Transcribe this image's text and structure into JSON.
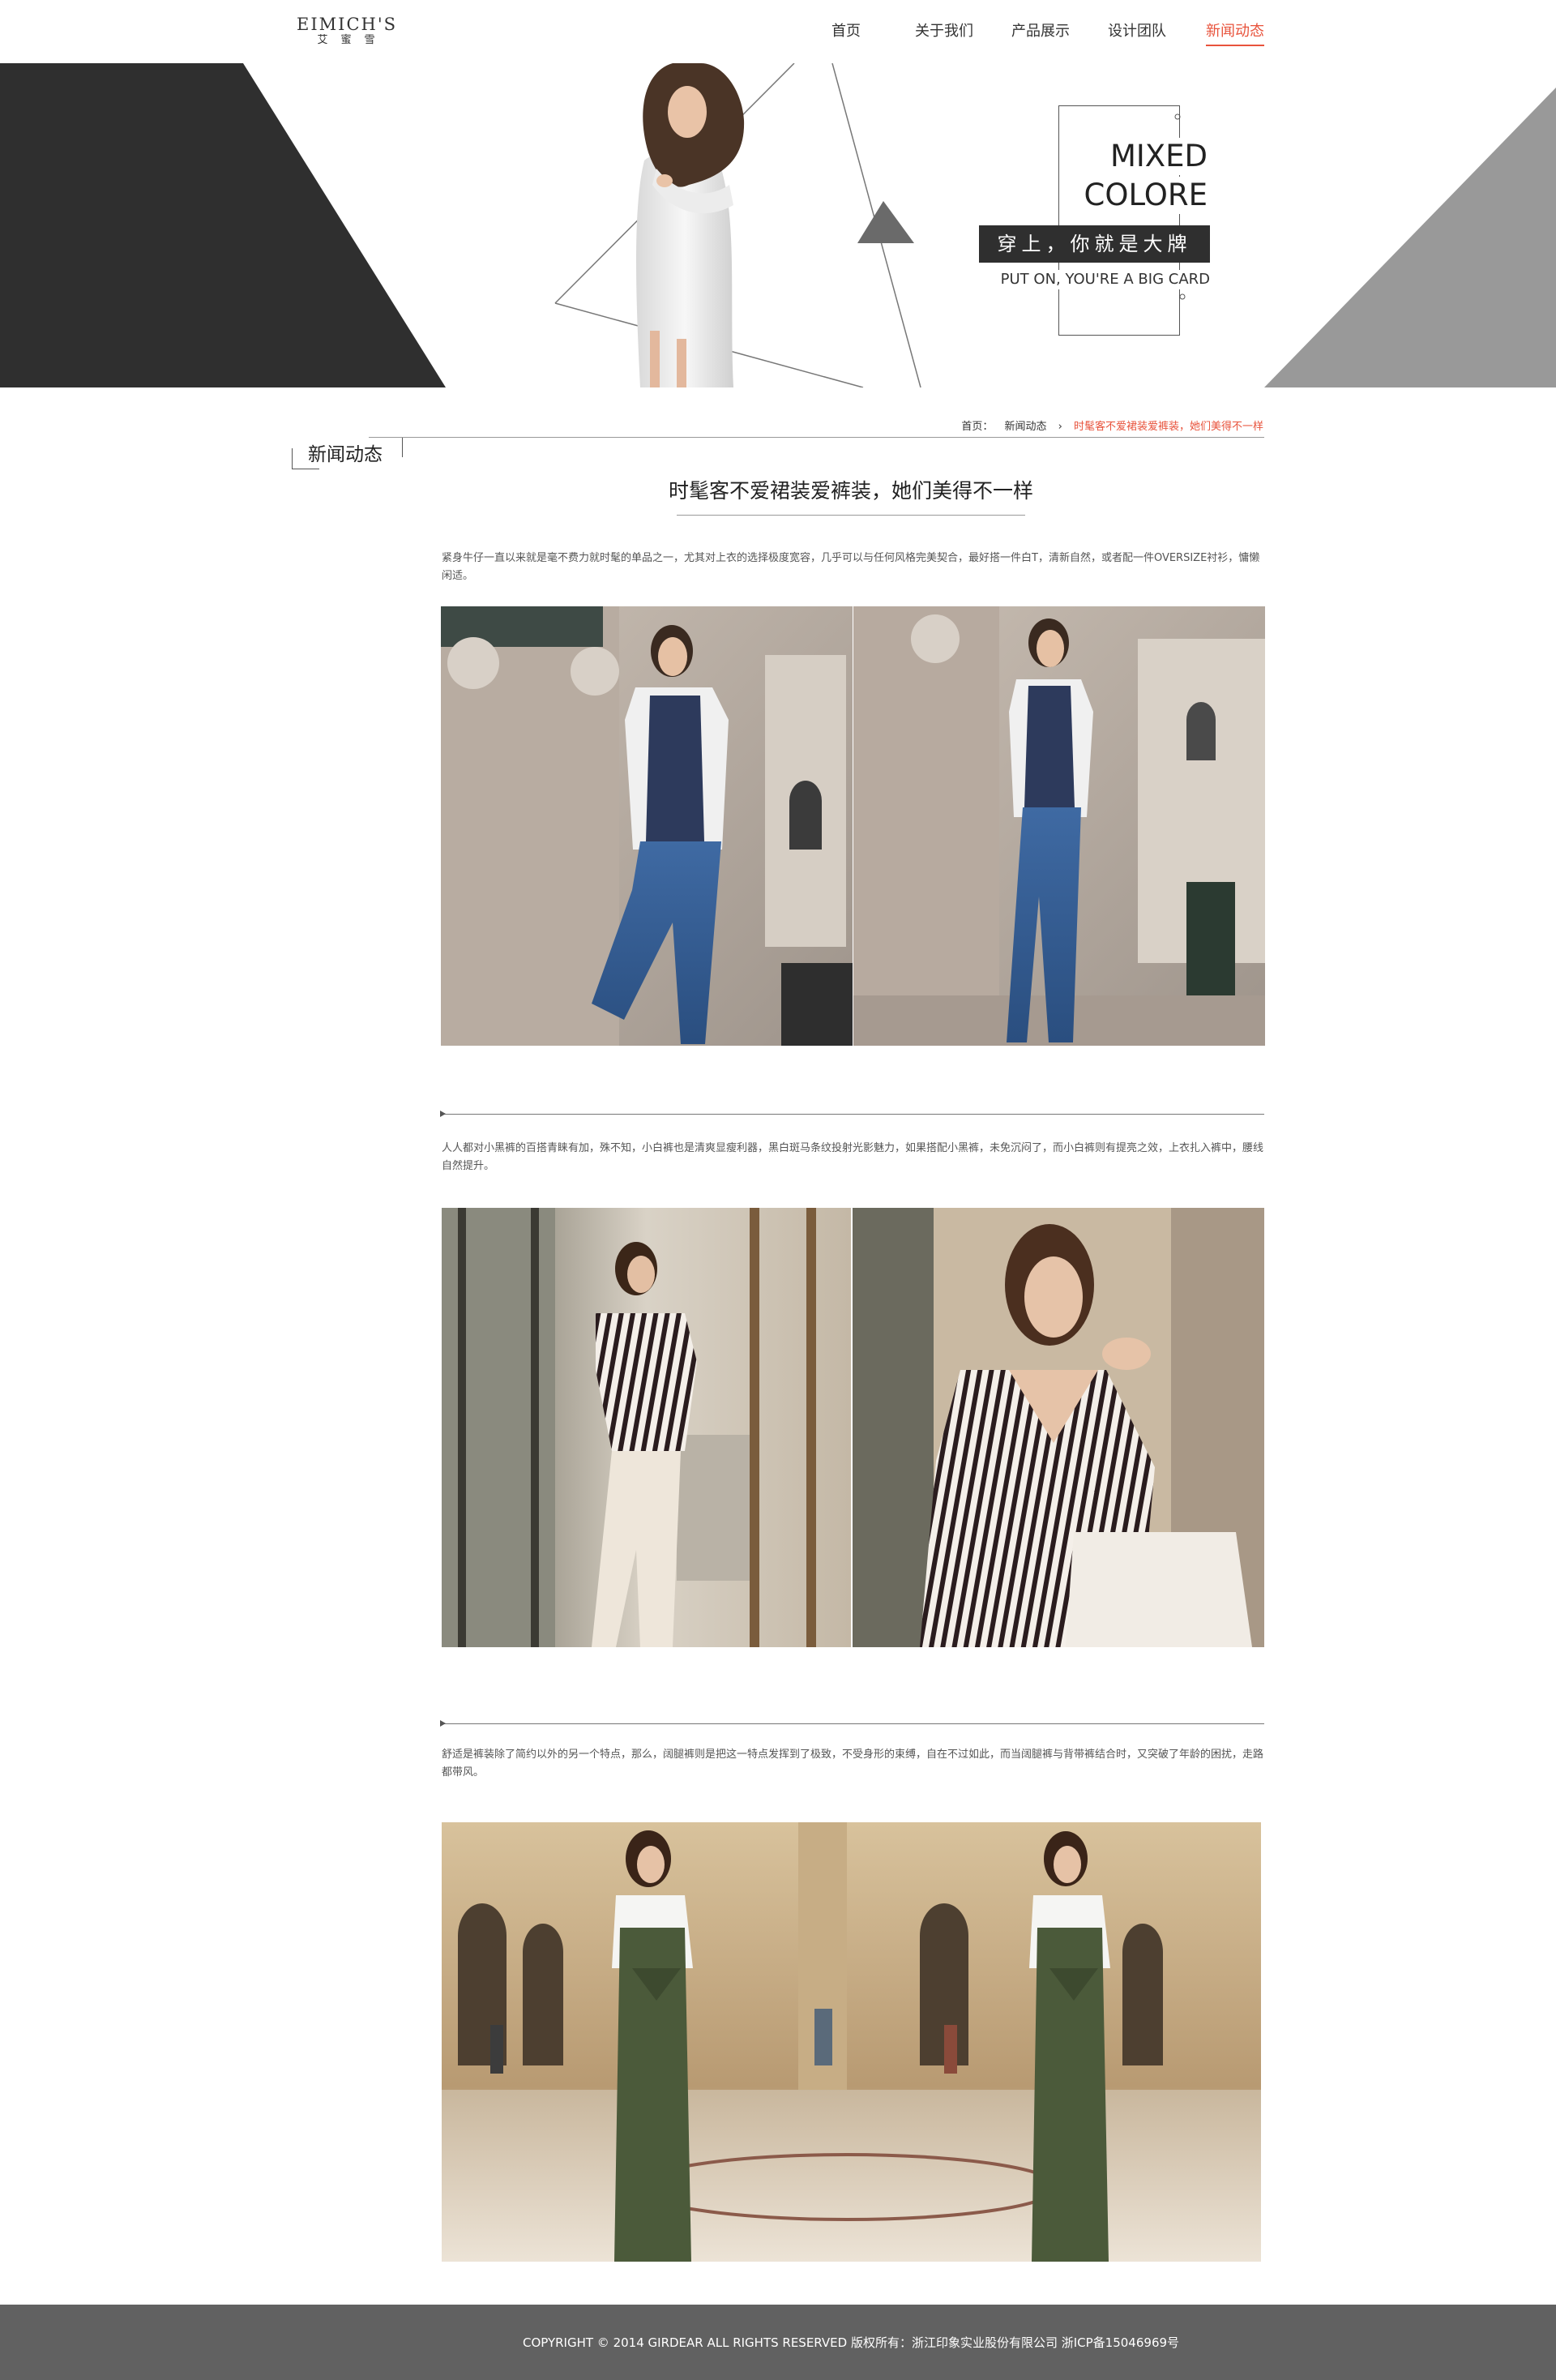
{
  "header": {
    "logo_en": "EIMICH'S",
    "logo_cn": "艾蜜雪",
    "nav": [
      "首页",
      "关于我们",
      "产品展示",
      "设计团队",
      "新闻动态"
    ],
    "active_nav": "新闻动态"
  },
  "banner": {
    "line1": "MIXED",
    "line2": "COLORE",
    "slogan_cn": "穿上，你就是大牌",
    "slogan_en": "PUT ON, YOU'RE A BIG CARD"
  },
  "breadcrumb": {
    "home": "首页：",
    "section": "新闻动态",
    "separator": "›",
    "current": "时髦客不爱裙装爱裤装，她们美得不一样"
  },
  "section_title": "新闻动态",
  "article": {
    "title": "时髦客不爱裙装爱裤装，她们美得不一样",
    "paragraphs": [
      "紧身牛仔一直以来就是毫不费力就时髦的单品之一，尤其对上衣的选择极度宽容，几乎可以与任何风格完美契合，最好搭一件白T，清新自然，或者配一件OVERSIZE衬衫，慵懒闲适。",
      "人人都对小黑裤的百搭青睐有加，殊不知，小白裤也是清爽显瘦利器，黑白斑马条纹投射光影魅力，如果搭配小黑裤，未免沉闷了，而小白裤则有提亮之效，上衣扎入裤中，腰线自然提升。",
      "舒适是裤装除了简约以外的另一个特点，那么，阔腿裤则是把这一特点发挥到了极致，不受身形的束缚，自在不过如此，而当阔腿裤与背带裤结合时，又突破了年龄的困扰，走路都带风。"
    ]
  },
  "footer": {
    "text": "COPYRIGHT © 2014 GIRDEAR ALL RIGHTS RESERVED 版权所有：浙江印象实业股份有限公司  浙ICP备15046969号"
  },
  "colors": {
    "accent": "#e8533c",
    "dark": "#2f2f2f",
    "gray_triangle": "#999999",
    "footer_bg": "#616161"
  }
}
